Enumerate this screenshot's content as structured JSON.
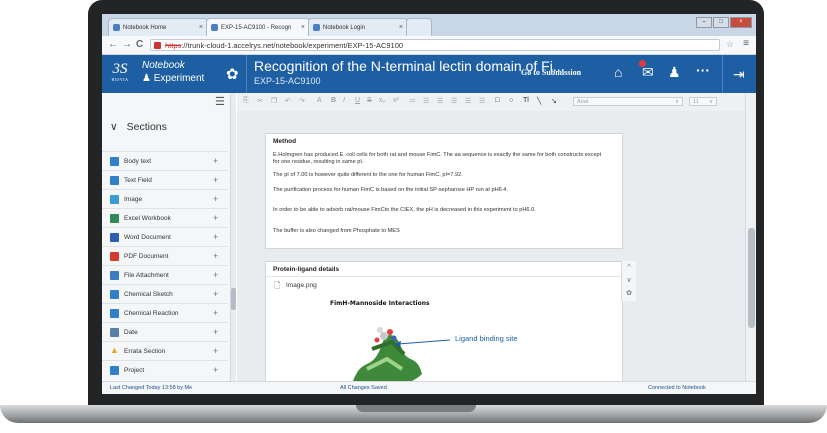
{
  "browser": {
    "tabs": [
      {
        "label": "Notebook Home"
      },
      {
        "label": "EXP-15-AC9100 - Recogn"
      },
      {
        "label": "Notebook Login"
      }
    ],
    "url_scheme": "https",
    "url_rest": "://trunk-cloud-1.accelrys.net/notebook/experiment/EXP-15-AC9100"
  },
  "header": {
    "logo_mark": "3S",
    "logo_text": "BIOVIA",
    "module": "Notebook",
    "submodule": "Experiment",
    "title": "Recognition of the N-terminal lectin domain of Fi...",
    "id": "EXP-15-AC9100",
    "go_to_submission": "Go to Submission"
  },
  "sidebar": {
    "title": "Sections",
    "items": [
      {
        "label": "Body text",
        "color": "#2f7fc9"
      },
      {
        "label": "Text Field",
        "color": "#2f7fc9"
      },
      {
        "label": "Image",
        "color": "#3a9bd5"
      },
      {
        "label": "Excel Workbook",
        "color": "#2e8b57"
      },
      {
        "label": "Word Document",
        "color": "#2b5fae"
      },
      {
        "label": "PDF Document",
        "color": "#d23b2e"
      },
      {
        "label": "File Attachment",
        "color": "#3a7cc2"
      },
      {
        "label": "Chemical Sketch",
        "color": "#2f7fc9"
      },
      {
        "label": "Chemical Reaction",
        "color": "#2f7fc9"
      },
      {
        "label": "Date",
        "color": "#5a7ea6"
      },
      {
        "label": "Errata Section",
        "color": "#f0a020"
      },
      {
        "label": "Project",
        "color": "#2f7fc9"
      }
    ]
  },
  "toolbar": {
    "font_select": "Arial",
    "size_select": "11"
  },
  "method": {
    "heading": "Method",
    "paragraphs": [
      "E.Holmgren has produced E. coli cells for both rat and mouse FimC. The aa sequence is exactly the same for both constructs except for one residue, resulting in same pI.",
      "The pI of 7.00 is however quite different to the one for human FimC, pI=7.92.",
      "The purification process for human FimC is based on the initial SP-sepharose HP run at pH6.4.",
      "In order to be able to adsorb rat/mouse FimCto the CIEX, the pH is decreased in this experiment to pH6.0.",
      "The buffer is also changed from Phosphate to MES"
    ]
  },
  "protein": {
    "heading": "Protein-ligand details",
    "file_name": "Image.png",
    "image_title": "FimH-Mannoside Interactions",
    "annotation": "Ligand binding site"
  },
  "status": {
    "left": "Last Changed Today 13:58 by Me",
    "center": "All Changes Saved",
    "right": "Connected to Notebook"
  }
}
